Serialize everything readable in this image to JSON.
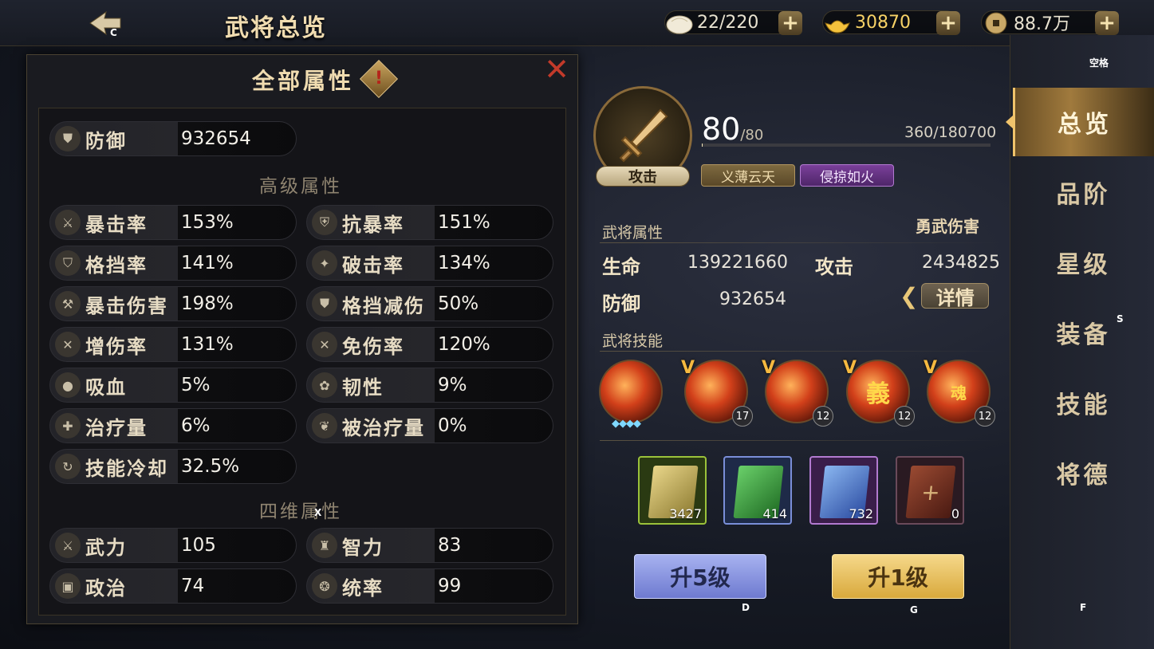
{
  "header": {
    "title": "武将总览",
    "back_key_hint": "C",
    "resources": [
      {
        "icon": "bun-icon",
        "value": "22/220"
      },
      {
        "icon": "gold-ingot-icon",
        "value": "30870",
        "color": "#f7d266"
      },
      {
        "icon": "coin-icon",
        "value": "88.7万"
      }
    ],
    "plus_label": "+"
  },
  "sidebar": {
    "key_hint": "空格",
    "items": [
      {
        "label": "总览",
        "active": true
      },
      {
        "label": "品阶"
      },
      {
        "label": "星级"
      },
      {
        "label": "装备"
      },
      {
        "label": "技能"
      },
      {
        "label": "将德"
      }
    ],
    "nav_key_hint": "S",
    "footer_key_hint": "F"
  },
  "hero": {
    "role": "攻击",
    "level": "80",
    "level_max": "/80",
    "exp": "360/180700",
    "exp_fraction": 0.002,
    "tags": [
      "义薄云天",
      "侵掠如火"
    ],
    "attr_section": "武将属性",
    "damage_type": "勇武伤害",
    "stats": {
      "hp_label": "生命",
      "hp_value": "139221660",
      "atk_label": "攻击",
      "atk_value": "2434825",
      "def_label": "防御",
      "def_value": "932654"
    },
    "detail_label": "详情",
    "skill_section": "武将技能",
    "skills": [
      {
        "level": ""
      },
      {
        "level": "17"
      },
      {
        "level": "12"
      },
      {
        "level": "12",
        "glyph": "義"
      },
      {
        "level": "12",
        "glyph": "魂"
      }
    ],
    "books": [
      {
        "count": "3427",
        "color": "#9bc23a"
      },
      {
        "count": "414",
        "color": "#4a9a3a"
      },
      {
        "count": "732",
        "color": "#6a8fd8"
      },
      {
        "count": "0",
        "color": "#7a2a22"
      }
    ],
    "btn_up5": "升5级",
    "btn_up5_key": "D",
    "btn_up1": "升1级",
    "btn_up1_key": "G"
  },
  "popup": {
    "title": "全部属性",
    "close": "✕",
    "close_key": "X",
    "basic": [
      {
        "label": "防御",
        "value": "932654",
        "icon": "shield-icon"
      }
    ],
    "advanced_title": "高级属性",
    "advanced": [
      {
        "label": "暴击率",
        "value": "153%"
      },
      {
        "label": "抗暴率",
        "value": "151%"
      },
      {
        "label": "格挡率",
        "value": "141%"
      },
      {
        "label": "破击率",
        "value": "134%"
      },
      {
        "label": "暴击伤害",
        "value": "198%"
      },
      {
        "label": "格挡减伤",
        "value": "50%"
      },
      {
        "label": "增伤率",
        "value": "131%"
      },
      {
        "label": "免伤率",
        "value": "120%"
      },
      {
        "label": "吸血",
        "value": "5%"
      },
      {
        "label": "韧性",
        "value": "9%"
      },
      {
        "label": "治疗量",
        "value": "6%"
      },
      {
        "label": "被治疗量",
        "value": "0%"
      },
      {
        "label": "技能冷却",
        "value": "32.5%"
      }
    ],
    "four_title": "四维属性",
    "four": [
      {
        "label": "武力",
        "value": "105"
      },
      {
        "label": "智力",
        "value": "83"
      },
      {
        "label": "政治",
        "value": "74"
      },
      {
        "label": "统率",
        "value": "99"
      }
    ]
  }
}
